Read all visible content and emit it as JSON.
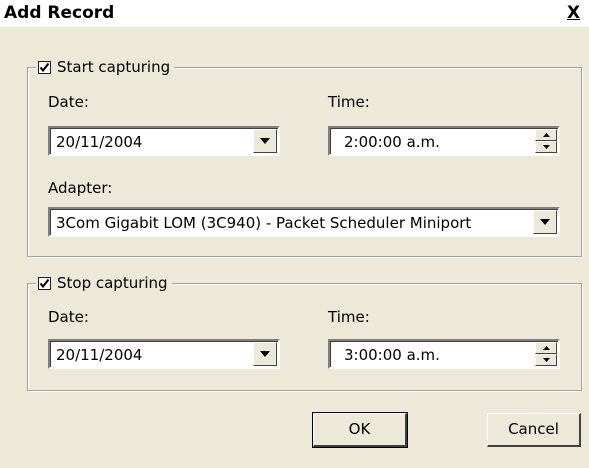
{
  "window": {
    "title": "Add Record",
    "close_label": "X"
  },
  "start": {
    "legend": "Start capturing",
    "checked": true,
    "date_label": "Date:",
    "date_value": "20/11/2004",
    "time_label": "Time:",
    "time_value": "2:00:00 a.m.",
    "adapter_label": "Adapter:",
    "adapter_value": "3Com Gigabit LOM (3C940) - Packet Scheduler Miniport"
  },
  "stop": {
    "legend": "Stop capturing",
    "checked": true,
    "date_label": "Date:",
    "date_value": "20/11/2004",
    "time_label": "Time:",
    "time_value": "3:00:00 a.m."
  },
  "buttons": {
    "ok": "OK",
    "cancel": "Cancel"
  }
}
